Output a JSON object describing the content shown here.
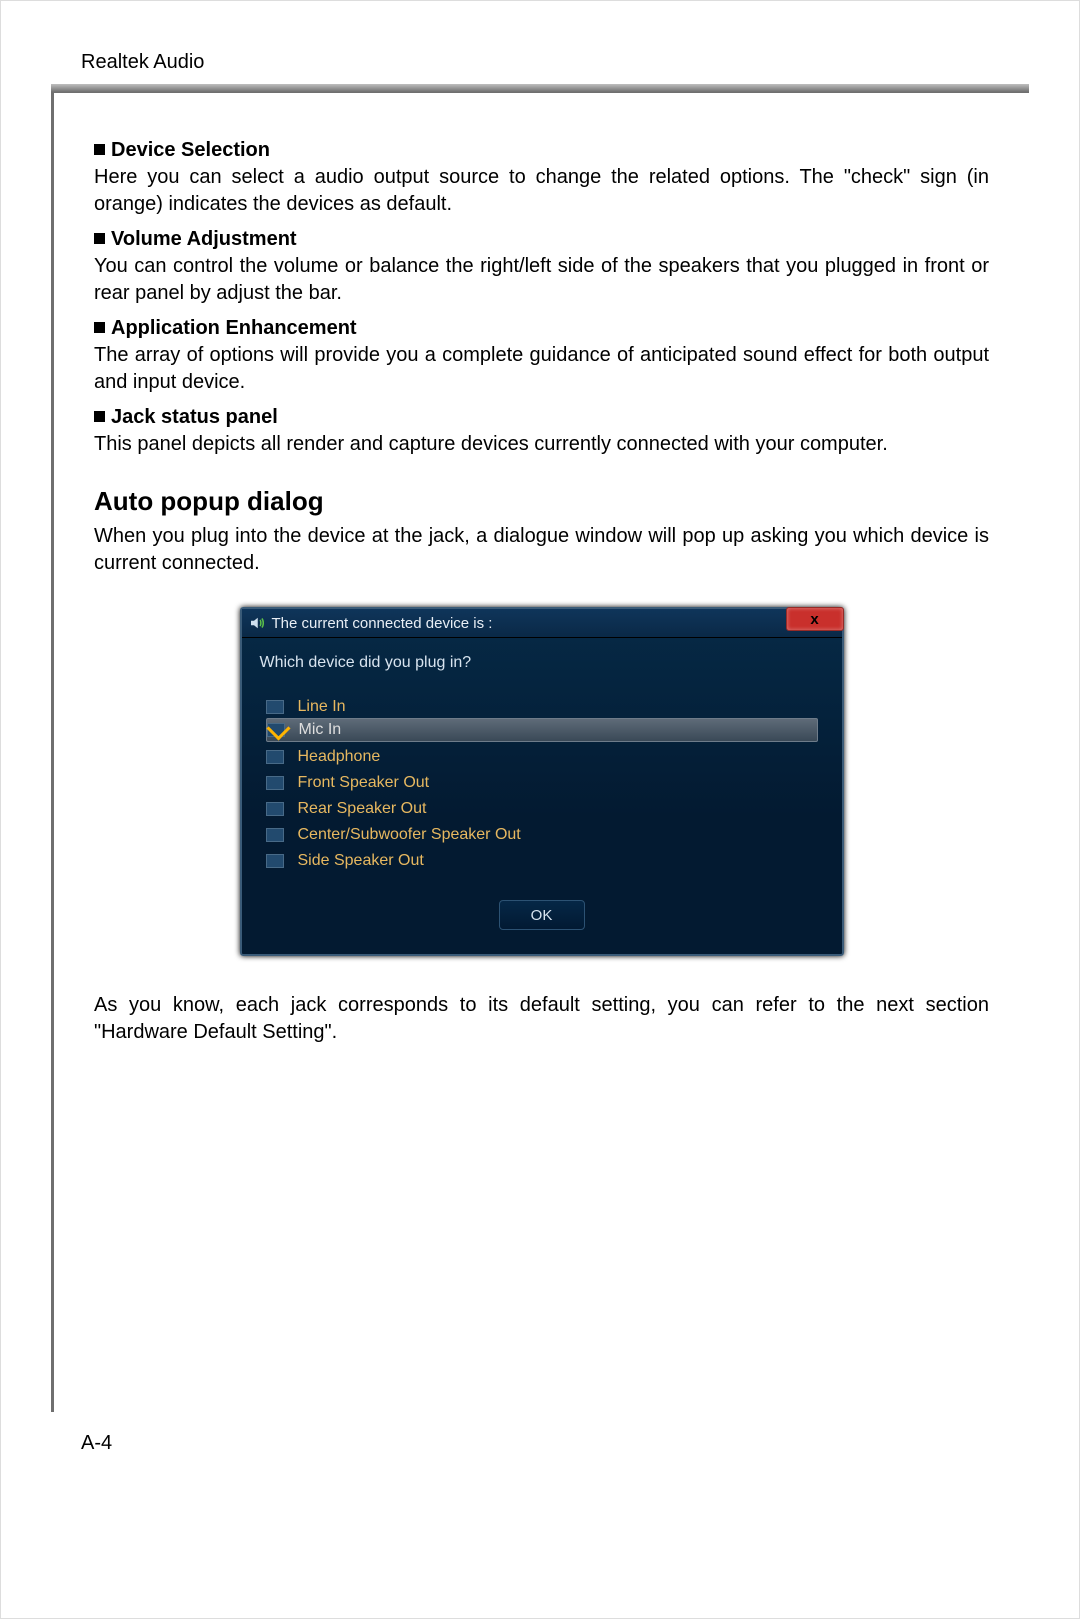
{
  "header": {
    "running_head": "Realtek Audio"
  },
  "features": [
    {
      "title": "Device Selection",
      "body": "Here you can select a audio output source to change the related options. The \"check\" sign (in orange) indicates the devices as default."
    },
    {
      "title": "Volume Adjustment",
      "body": "You can control the volume or balance the right/left side of the speakers that you plugged in front or rear panel by adjust the bar."
    },
    {
      "title": "Application Enhancement",
      "body": "The array of options will provide you a complete guidance of anticipated sound effect for both output and input device."
    },
    {
      "title": "Jack status panel",
      "body": "This panel depicts all render and capture devices currently connected with your computer."
    }
  ],
  "auto_popup": {
    "heading": "Auto popup dialog",
    "intro": "When you plug into the device at the jack, a dialogue window will pop up asking you which device is current connected."
  },
  "dialog": {
    "title": "The current connected device is :",
    "question": "Which device did you plug in?",
    "devices": [
      {
        "label": "Line In",
        "checked": false,
        "selected": false
      },
      {
        "label": "Mic In",
        "checked": true,
        "selected": true
      },
      {
        "label": "Headphone",
        "checked": false,
        "selected": false
      },
      {
        "label": "Front Speaker Out",
        "checked": false,
        "selected": false
      },
      {
        "label": "Rear Speaker Out",
        "checked": false,
        "selected": false
      },
      {
        "label": "Center/Subwoofer Speaker Out",
        "checked": false,
        "selected": false
      },
      {
        "label": "Side Speaker Out",
        "checked": false,
        "selected": false
      }
    ],
    "ok_label": "OK",
    "close_glyph": "x"
  },
  "closing_text": "As you know, each jack corresponds to its default setting, you can refer to the next section \"Hardware Default Setting\".",
  "page_number": "A-4"
}
